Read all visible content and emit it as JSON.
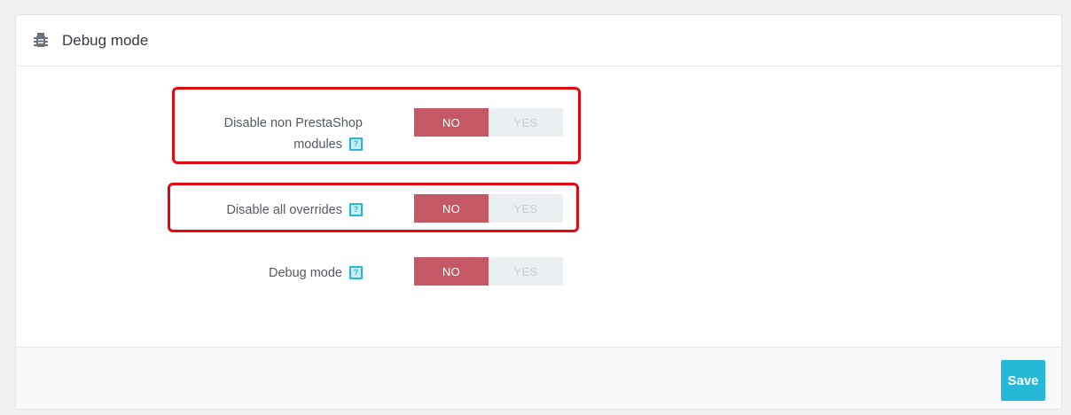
{
  "header": {
    "icon": "bug-icon",
    "title": "Debug mode"
  },
  "options": [
    {
      "label_line1": "Disable non PrestaShop",
      "label_line2": "modules",
      "help": "?",
      "no_label": "NO",
      "yes_label": "YES",
      "value": "NO",
      "highlighted": true
    },
    {
      "label": "Disable all overrides",
      "help": "?",
      "no_label": "NO",
      "yes_label": "YES",
      "value": "NO",
      "highlighted": true
    },
    {
      "label": "Debug mode",
      "help": "?",
      "no_label": "NO",
      "yes_label": "YES",
      "value": "NO",
      "highlighted": false
    }
  ],
  "footer": {
    "save_label": "Save"
  },
  "colors": {
    "no_active": "#c45965",
    "yes_inactive": "#eceff1",
    "accent": "#25b9d7",
    "highlight_box": "#e1080f"
  }
}
